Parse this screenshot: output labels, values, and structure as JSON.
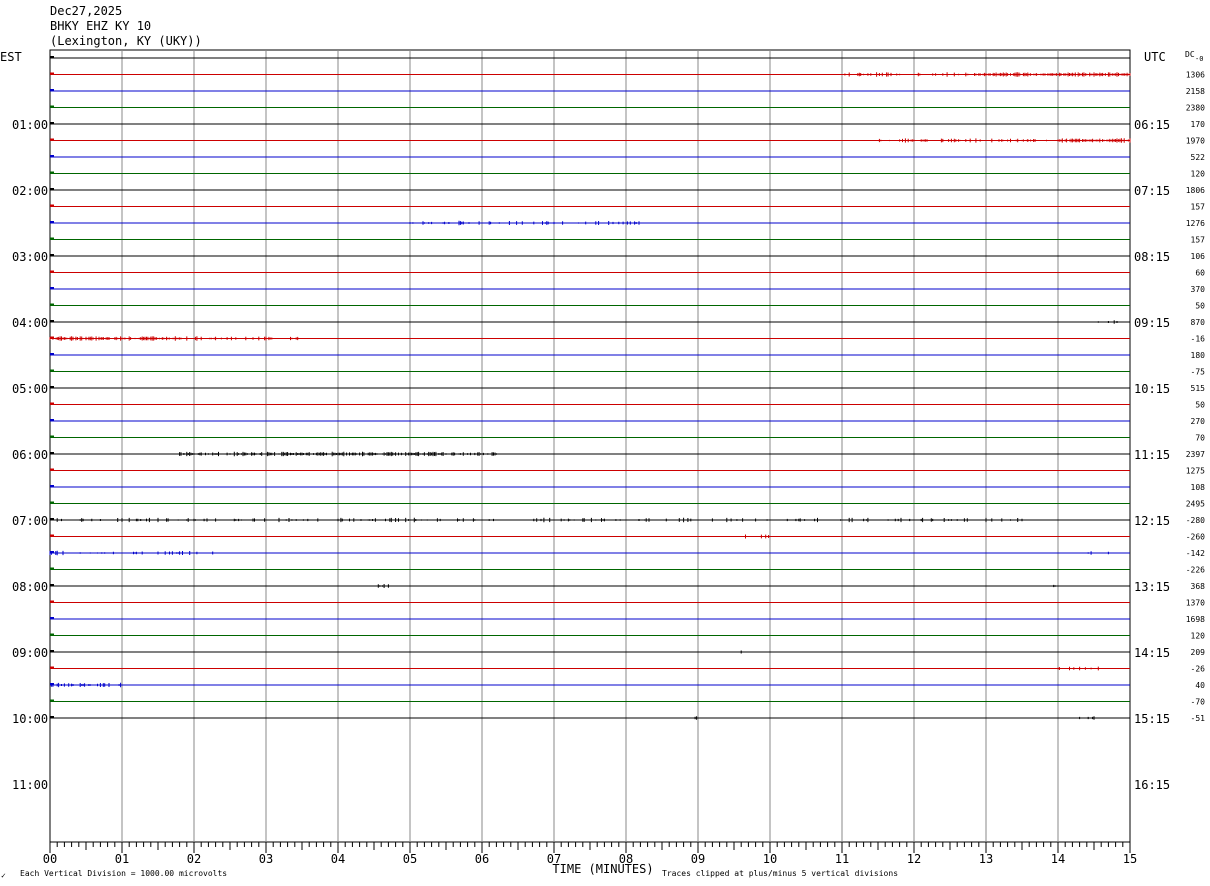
{
  "header": {
    "date": "Dec27,2025",
    "station": "BHKY EHZ KY 10",
    "location": "(Lexington, KY (UKY))"
  },
  "footer": {
    "scale_note": "Each Vertical Division = 1000.00 microvolts",
    "clip_note": "Traces clipped at plus/minus 5 vertical divisions",
    "corner_mark": "✓"
  },
  "chart_data": {
    "type": "line",
    "title": "BHKY EHZ KY 10",
    "xlabel": "TIME (MINUTES)",
    "left_axis_label": "EST",
    "right_axis_label": "UTC",
    "dc_label": "DC",
    "dc_unit": "-0",
    "xlim": [
      0,
      15
    ],
    "x_ticks": [
      "00",
      "01",
      "02",
      "03",
      "04",
      "05",
      "06",
      "07",
      "08",
      "09",
      "10",
      "11",
      "12",
      "13",
      "14",
      "15"
    ],
    "rows_per_hour": 4,
    "hours": 12,
    "hour_labels_est": [
      "01:00",
      "02:00",
      "03:00",
      "04:00",
      "05:00",
      "06:00",
      "07:00",
      "08:00",
      "09:00",
      "10:00",
      "11:00"
    ],
    "hour_labels_utc": [
      "06:15",
      "07:15",
      "08:15",
      "09:15",
      "10:15",
      "11:15",
      "12:15",
      "13:15",
      "14:15",
      "15:15",
      "16:15"
    ],
    "trace_colors": [
      "#000000",
      "#cc0000",
      "#0000cc",
      "#006600"
    ],
    "grid": true,
    "dc_offsets": [
      "1306",
      "2158",
      "2380",
      "170",
      "1970",
      "522",
      "120",
      "1806",
      "157",
      "1276",
      "157",
      "106",
      "60",
      "370",
      "50",
      "870",
      "-16",
      "180",
      "-75",
      "515",
      "50",
      "270",
      "70",
      "2397",
      "1275",
      "108",
      "2495",
      "-280",
      "-260",
      "-142",
      "-226",
      "368",
      "1370",
      "1698",
      "120",
      "209",
      "-26",
      "40",
      "-70",
      "-51"
    ],
    "trace_count": 41,
    "activity": [
      {
        "trace": 1,
        "segments": [
          [
            11.0,
            13.0,
            0.25
          ],
          [
            13.0,
            15.0,
            0.9
          ]
        ]
      },
      {
        "trace": 5,
        "segments": [
          [
            11.5,
            14.0,
            0.3
          ],
          [
            14.0,
            15.0,
            0.9
          ]
        ]
      },
      {
        "trace": 10,
        "segments": [
          [
            5.0,
            8.2,
            0.2
          ]
        ]
      },
      {
        "trace": 16,
        "segments": [
          [
            14.5,
            15.0,
            0.3
          ]
        ]
      },
      {
        "trace": 17,
        "segments": [
          [
            0.0,
            1.8,
            0.8
          ],
          [
            1.8,
            3.5,
            0.35
          ]
        ]
      },
      {
        "trace": 24,
        "segments": [
          [
            1.8,
            3.2,
            0.45
          ],
          [
            3.2,
            6.2,
            0.7
          ]
        ]
      },
      {
        "trace": 28,
        "segments": [
          [
            0.0,
            13.5,
            0.2
          ]
        ]
      },
      {
        "trace": 29,
        "segments": [
          [
            9.5,
            10.0,
            0.15
          ]
        ]
      },
      {
        "trace": 30,
        "segments": [
          [
            0.0,
            2.5,
            0.2
          ],
          [
            14.3,
            14.7,
            0.2
          ]
        ]
      },
      {
        "trace": 32,
        "segments": [
          [
            4.5,
            4.7,
            0.2
          ],
          [
            13.9,
            14.1,
            0.2
          ]
        ]
      },
      {
        "trace": 36,
        "segments": [
          [
            9.4,
            9.6,
            0.15
          ]
        ]
      },
      {
        "trace": 37,
        "segments": [
          [
            14.0,
            14.6,
            0.25
          ]
        ]
      },
      {
        "trace": 38,
        "segments": [
          [
            0.0,
            1.2,
            0.5
          ]
        ]
      },
      {
        "trace": 40,
        "segments": [
          [
            8.9,
            9.1,
            0.15
          ],
          [
            14.3,
            14.5,
            0.15
          ]
        ]
      }
    ]
  }
}
